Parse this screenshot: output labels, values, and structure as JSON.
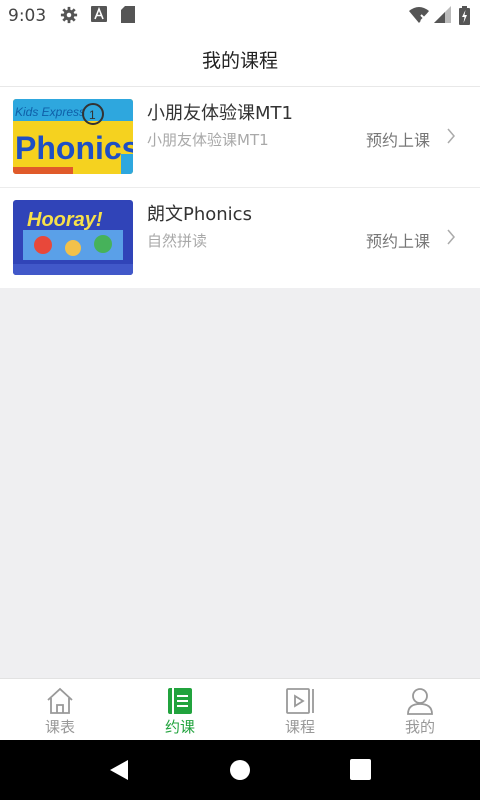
{
  "status_bar": {
    "time": "9:03"
  },
  "header": {
    "title": "我的课程"
  },
  "courses": [
    {
      "name": "小朋友体验课MT1",
      "description": "小朋友体验课MT1",
      "action": "预约上课",
      "thumb_text": "Phonics"
    },
    {
      "name": "朗文Phonics",
      "description": "自然拼读",
      "action": "预约上课",
      "thumb_text": "Hooray!"
    }
  ],
  "tabs": [
    {
      "label": "课表",
      "icon": "home-icon",
      "active": false
    },
    {
      "label": "约课",
      "icon": "book-icon",
      "active": true
    },
    {
      "label": "课程",
      "icon": "video-icon",
      "active": false
    },
    {
      "label": "我的",
      "icon": "user-icon",
      "active": false
    }
  ],
  "colors": {
    "accent": "#21a33d",
    "background": "#efeff1"
  }
}
